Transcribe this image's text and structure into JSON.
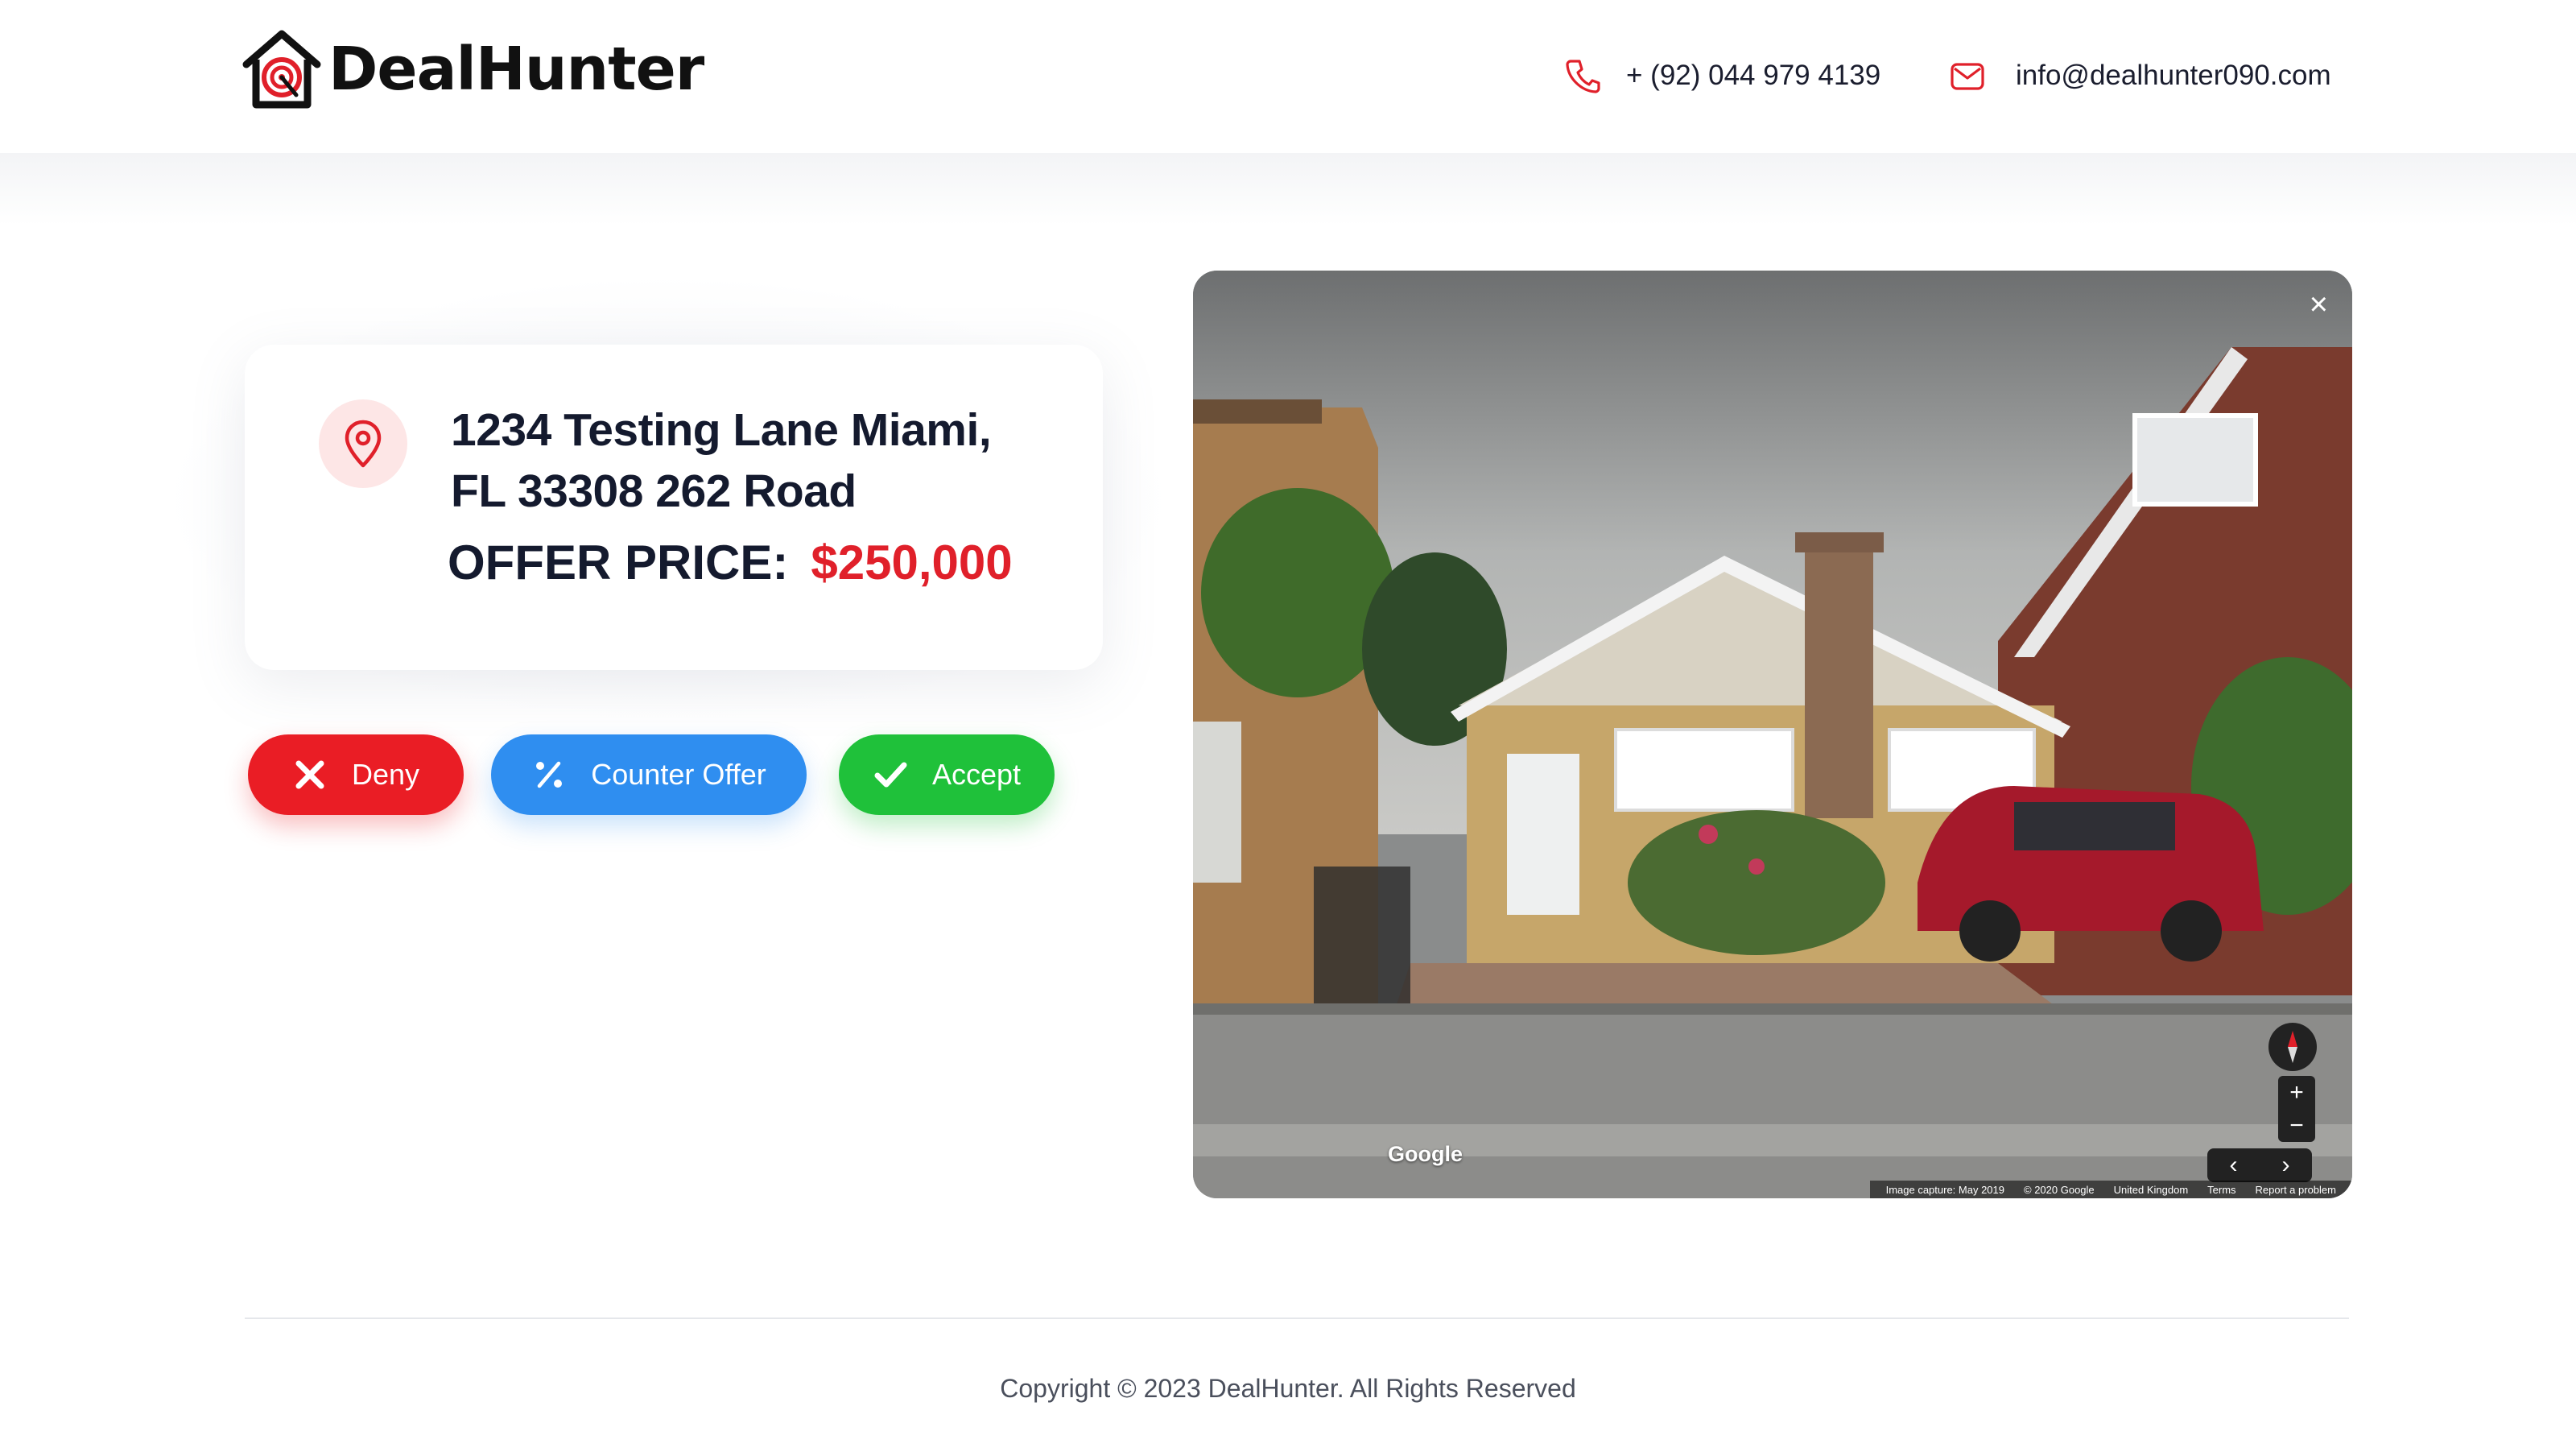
{
  "header": {
    "logo_text": "DealHunter",
    "phone": "+ (92) 044 979 4139",
    "email": "info@dealhunter090.com"
  },
  "property": {
    "address_line1": "1234 Testing Lane  Miami,",
    "address_line2": "FL 33308 262  Road",
    "offer_label": "OFFER PRICE:",
    "offer_price": "$250,000"
  },
  "actions": {
    "deny_label": "Deny",
    "counter_label": "Counter Offer",
    "accept_label": "Accept"
  },
  "street_view": {
    "close_glyph": "×",
    "brand": "Google",
    "zoom_in": "+",
    "zoom_out": "−",
    "nav_prev": "‹",
    "nav_next": "›",
    "footer": [
      "Image capture: May 2019",
      "© 2020 Google",
      "United Kingdom",
      "Terms",
      "Report a problem"
    ]
  },
  "footer": {
    "copyright": "Copyright © 2023 DealHunter. All Rights Reserved"
  },
  "colors": {
    "brand_red": "#e0202a",
    "deny": "#ea1d25",
    "counter": "#2f8ef0",
    "accept": "#1fc13a",
    "text_dark": "#141a2e"
  },
  "icons": {
    "logo": "house-target-icon",
    "phone": "phone-icon",
    "email": "envelope-icon",
    "location": "map-pin-icon",
    "deny": "x-icon",
    "counter": "percent-icon",
    "accept": "check-icon"
  }
}
